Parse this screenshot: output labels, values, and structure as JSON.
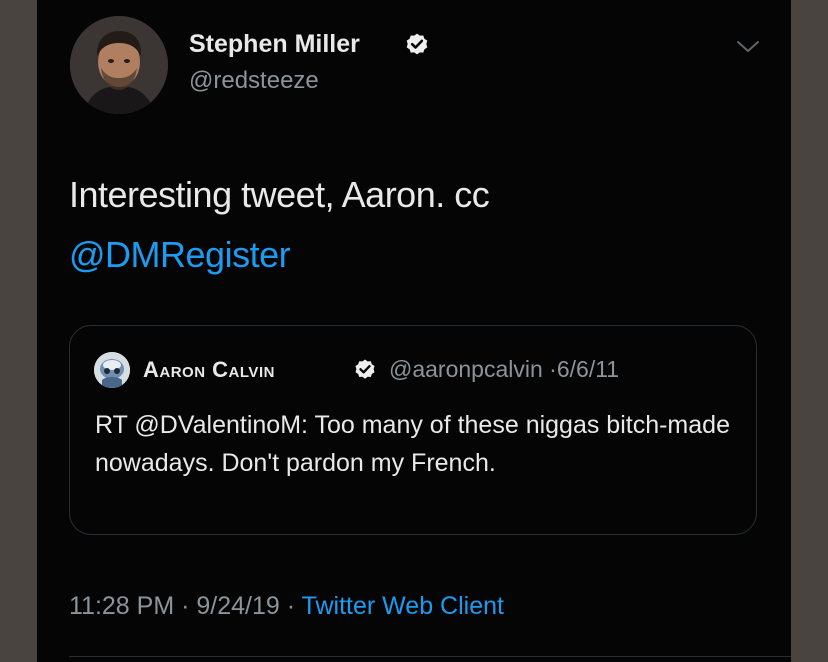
{
  "tweet": {
    "author": {
      "name": "Stephen Miller",
      "handle": "@redsteeze",
      "verified": true
    },
    "text_before_mention": "Interesting tweet, Aaron. cc",
    "mention": "@DMRegister",
    "quoted": {
      "name": "Aaron Calvin",
      "handle": "@aaronpcalvin",
      "separator": "·",
      "date": "6/6/11",
      "verified": true,
      "text": "RT @DValentinoM: Too many of these niggas bitch-made nowadays. Don't pardon my French."
    },
    "footer": {
      "time": "11:28 PM",
      "separator": "·",
      "date": "9/24/19",
      "client": "Twitter Web Client"
    }
  },
  "colors": {
    "background": "#050505",
    "outer_background": "#4a4441",
    "text_primary": "#e9e9e9",
    "text_secondary": "#8b949b",
    "link": "#1d9bf0",
    "border": "#2a2f33"
  },
  "icons": [
    "verified-badge-icon",
    "chevron-down-icon"
  ]
}
